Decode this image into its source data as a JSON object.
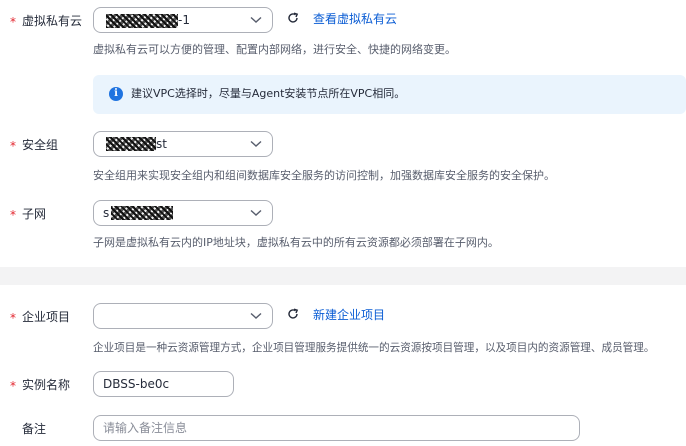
{
  "vpc": {
    "required_mark": "*",
    "label": "虚拟私有云",
    "selected_suffix": "-1",
    "view_link": "查看虚拟私有云",
    "hint": "虚拟私有云可以方便的管理、配置内部网络，进行安全、快捷的网络变更。"
  },
  "info": {
    "icon": "info-icon",
    "text": "建议VPC选择时，尽量与Agent安装节点所在VPC相同。"
  },
  "security_group": {
    "required_mark": "*",
    "label": "安全组",
    "selected_suffix": "st",
    "hint": "安全组用来实现安全组内和组间数据库安全服务的访问控制，加强数据库安全服务的安全保护。"
  },
  "subnet": {
    "required_mark": "*",
    "label": "子网",
    "selected_prefix": "s",
    "hint": "子网是虚拟私有云内的IP地址块，虚拟私有云中的所有云资源都必须部署在子网内。"
  },
  "enterprise_project": {
    "required_mark": "*",
    "label": "企业项目",
    "selected": "",
    "create_link": "新建企业项目",
    "hint": "企业项目是一种云资源管理方式，企业项目管理服务提供统一的云资源按项目管理，以及项目内的资源管理、成员管理。"
  },
  "instance_name": {
    "required_mark": "*",
    "label": "实例名称",
    "value": "DBSS-be0c"
  },
  "remark": {
    "label": "备注",
    "placeholder": "请输入备注信息"
  },
  "colors": {
    "required": "#e3262f",
    "link": "#0a5cd4",
    "info_bg": "#eaf4fd",
    "info_icon": "#1f73e0",
    "border": "#adb0b8"
  }
}
